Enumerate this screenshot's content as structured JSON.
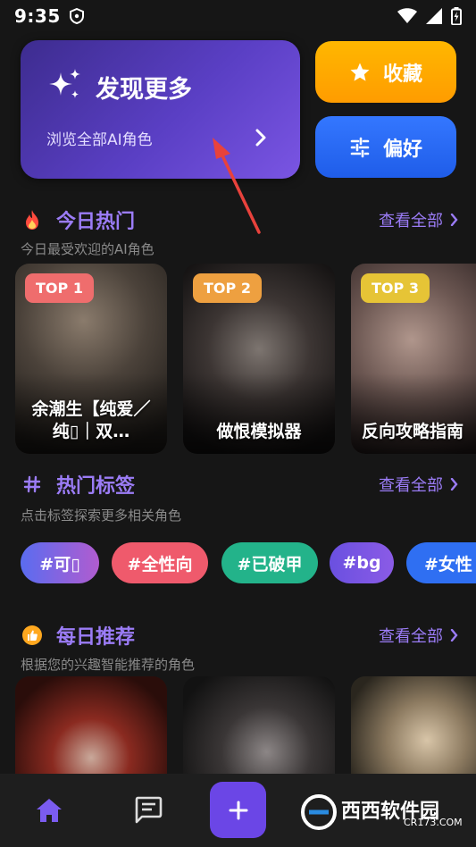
{
  "status": {
    "time": "9:35"
  },
  "discover": {
    "title": "发现更多",
    "subtitle": "浏览全部AI角色"
  },
  "favorites": {
    "label": "收藏"
  },
  "preferences": {
    "label": "偏好"
  },
  "hot_today": {
    "title": "今日热门",
    "subtitle": "今日最受欢迎的AI角色",
    "more": "查看全部",
    "cards": [
      {
        "badge": "TOP 1",
        "name": "余潮生【纯爱／纯▯｜双…"
      },
      {
        "badge": "TOP 2",
        "name": "做恨模拟器"
      },
      {
        "badge": "TOP 3",
        "name": "反向攻略指南"
      }
    ]
  },
  "hot_tags": {
    "title": "热门标签",
    "subtitle": "点击标签探索更多相关角色",
    "more": "查看全部",
    "tags": [
      "#可▯",
      "#全性向",
      "#已破甲",
      "#bg",
      "#女性"
    ]
  },
  "daily": {
    "title": "每日推荐",
    "subtitle": "根据您的兴趣智能推荐的角色",
    "more": "查看全部"
  },
  "watermark": {
    "text": "西西软件园",
    "url": "CR173.COM"
  },
  "colors": {
    "accent": "#9b7cf6",
    "gold": "#ffa800",
    "blue": "#2a6cf6",
    "badge1": "#f07070",
    "badge2": "#f0a040",
    "badge3": "#ecc53a"
  }
}
